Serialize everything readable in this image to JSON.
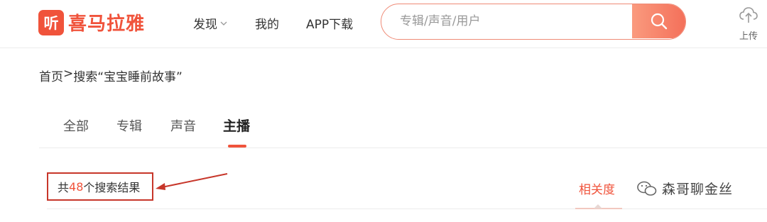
{
  "header": {
    "logo_mark": "听",
    "logo_text": "喜马拉雅",
    "nav": [
      {
        "label": "发现"
      },
      {
        "label": "我的"
      },
      {
        "label": "APP下载"
      }
    ],
    "search_placeholder": "专辑/声音/用户",
    "upload_label": "上传"
  },
  "breadcrumb": {
    "home": "首页",
    "separator": ">",
    "current": "搜索“宝宝睡前故事”"
  },
  "tabs": [
    {
      "label": "全部"
    },
    {
      "label": "专辑"
    },
    {
      "label": "声音"
    },
    {
      "label": "主播",
      "active": true
    }
  ],
  "results": {
    "prefix": "共",
    "count": "48",
    "suffix": "个搜索结果"
  },
  "sort": {
    "label": "相关度"
  },
  "watermark": {
    "text": "森哥聊金丝"
  },
  "colors": {
    "accent": "#f0533b",
    "annotation": "#c7362a"
  }
}
